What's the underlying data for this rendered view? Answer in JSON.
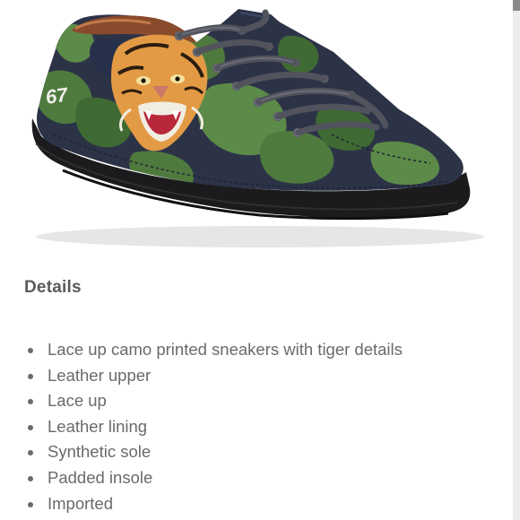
{
  "product": {
    "image_description_icon": "camo-tiger-sneaker",
    "tiger_patch_number": "67"
  },
  "details": {
    "heading": "Details",
    "items": [
      "Lace up camo printed sneakers with tiger details",
      "Leather upper",
      "Lace up",
      "Leather lining",
      "Synthetic sole",
      "Padded insole",
      "Imported"
    ]
  },
  "colors": {
    "text": "#6a6a6a",
    "heading": "#5a5a5a",
    "sole": "#1b1b1d",
    "camo_green": "#4f7a3e",
    "camo_navy": "#2c3347"
  }
}
